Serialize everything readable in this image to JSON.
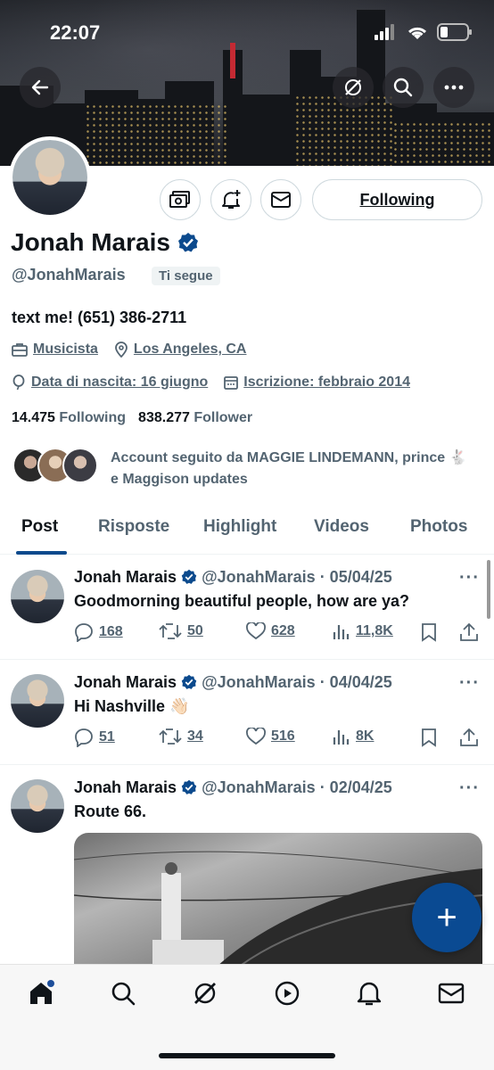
{
  "status": {
    "time": "22:07"
  },
  "profile": {
    "name": "Jonah Marais",
    "handle": "@JonahMarais",
    "follows_you": "Ti segue",
    "follow_button": "Following",
    "bio": "text me! (651) 386-2711",
    "profession": "Musicista",
    "location": "Los Angeles, CA",
    "birthday": "Data di nascita: 16 giugno",
    "joined": "Iscrizione: febbraio 2014",
    "following_count": "14.475",
    "following_label": "Following",
    "followers_count": "838.277",
    "followers_label": "Follower",
    "followed_by": "Account seguito da MAGGIE LINDEMANN, prince 🐇 e Maggison updates",
    "verified_color": "#1d9bf0"
  },
  "tabs": [
    "Post",
    "Risposte",
    "Highlight",
    "Videos",
    "Photos"
  ],
  "posts": [
    {
      "name": "Jonah Marais",
      "handle": "@JonahMarais",
      "date": "· 05/04/25",
      "text": "Goodmorning beautiful people, how are ya?",
      "replies": "168",
      "reposts": "50",
      "likes": "628",
      "views": "11,8K"
    },
    {
      "name": "Jonah Marais",
      "handle": "@JonahMarais",
      "date": "· 04/04/25",
      "text": "Hi Nashville 👋🏻",
      "replies": "51",
      "reposts": "34",
      "likes": "516",
      "views": "8K"
    },
    {
      "name": "Jonah Marais",
      "handle": "@JonahMarais",
      "date": "· 02/04/25",
      "text": "Route 66."
    }
  ],
  "fab": {
    "label": "+"
  }
}
